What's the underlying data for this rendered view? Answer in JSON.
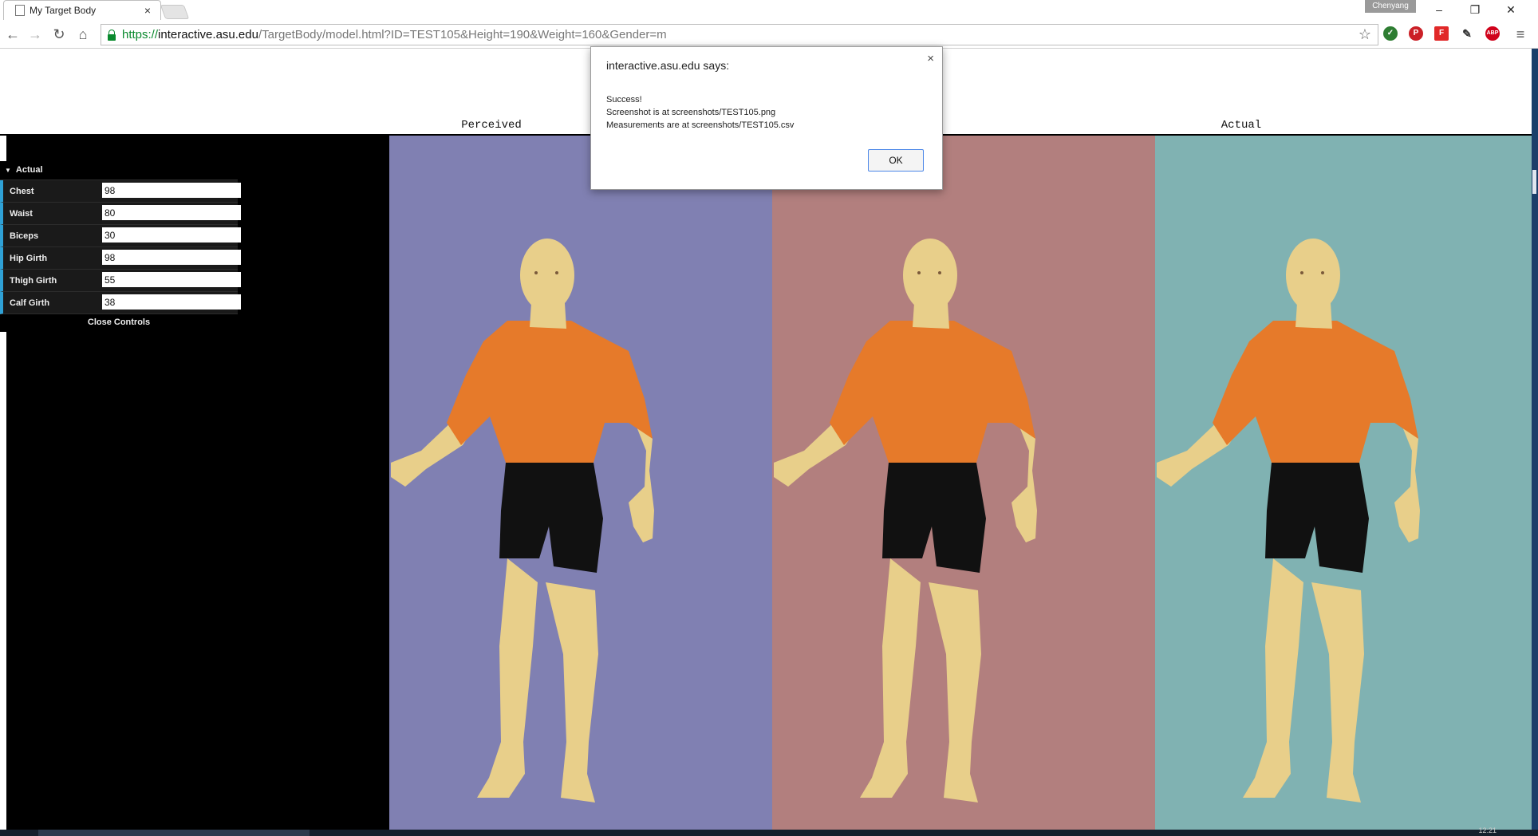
{
  "browser": {
    "tab_title": "My Target Body",
    "user_name": "Chenyang",
    "url_scheme": "https://",
    "url_host": "interactive.asu.edu",
    "url_path": "/TargetBody/model.html?ID=TEST105&Height=190&Weight=160&Gender=m",
    "extensions": [
      "globe-icon",
      "pinterest-icon",
      "flipboard-icon",
      "eyedropper-icon",
      "adblock-icon"
    ],
    "adblock_label": "ABP"
  },
  "gui": {
    "folder_label": "Actual",
    "fields": [
      {
        "label": "Chest",
        "value": "98"
      },
      {
        "label": "Waist",
        "value": "80"
      },
      {
        "label": "Biceps",
        "value": "30"
      },
      {
        "label": "Hip Girth",
        "value": "98"
      },
      {
        "label": "Thigh Girth",
        "value": "55"
      },
      {
        "label": "Calf Girth",
        "value": "38"
      }
    ],
    "close_label": "Close Controls",
    "accent": "#2fa1d6"
  },
  "panels": [
    {
      "label": "Perceived",
      "background": "#8080b2"
    },
    {
      "label": "",
      "background": "#b27f7e"
    },
    {
      "label": "Actual",
      "background": "#80b2b2"
    }
  ],
  "body_colors": {
    "skin": "#e8cf8a",
    "shirt": "#e67a2a",
    "shorts": "#111111"
  },
  "dialog": {
    "title": "interactive.asu.edu says:",
    "line1": "Success!",
    "line2": "Screenshot is at screenshots/TEST105.png",
    "line3": "Measurements are at screenshots/TEST105.csv",
    "ok_label": "OK"
  },
  "taskbar": {
    "clock": "12:21"
  }
}
